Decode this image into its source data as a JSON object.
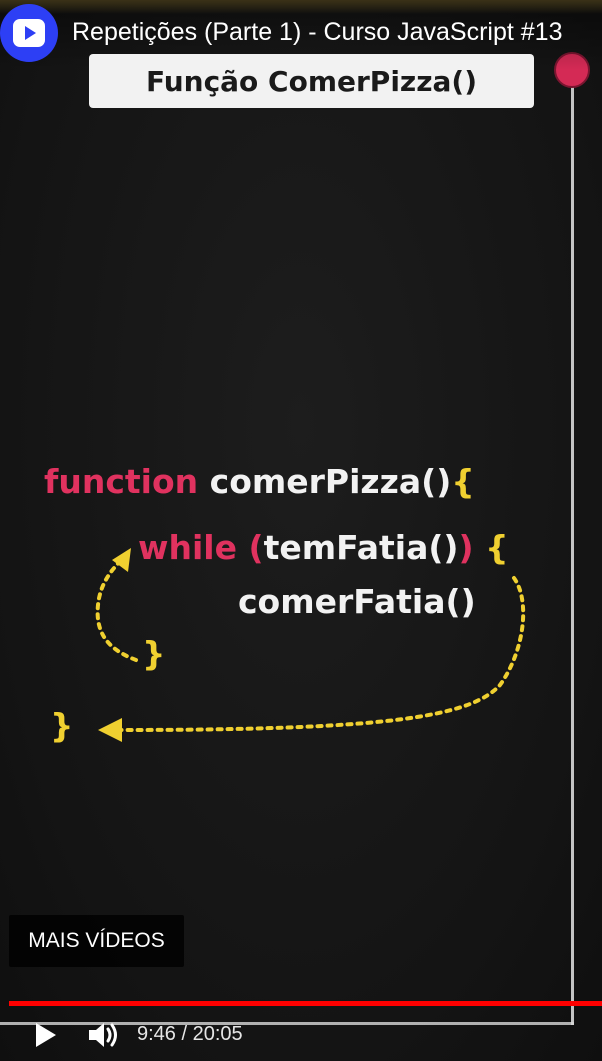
{
  "player": {
    "title": "Repetições (Parte 1) - Curso JavaScript #13",
    "more_videos_label": "MAIS VÍDEOS",
    "time_current": "9:46",
    "time_separator": " / ",
    "time_total": "20:05",
    "progress_fraction": 1.0,
    "accent_color": "#ff0000",
    "logo_color": "#2d3ff5"
  },
  "slide": {
    "banner": "Função ComerPizza()",
    "line1_keyword": "function",
    "line1_name": "comerPizza()",
    "line1_brace": "{",
    "line2_keyword": "while",
    "line2_paren_open": "(",
    "line2_cond": "temFatia()",
    "line2_paren_close": ")",
    "line2_brace": "{",
    "line3_call": "comerFatia()",
    "line4_brace": "}",
    "line5_brace": "}",
    "keyword_color": "#e0325f",
    "brace_color": "#f0d030"
  },
  "icons": {
    "logo": "video-logo-icon",
    "play": "play-icon",
    "volume": "volume-icon"
  }
}
